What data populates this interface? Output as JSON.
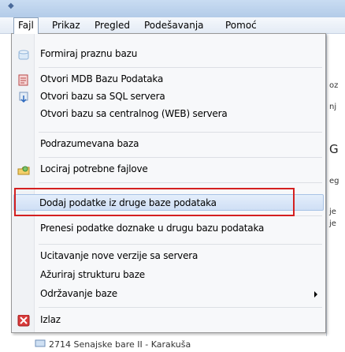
{
  "menubar": {
    "items": [
      "Fajl",
      "Prikaz",
      "Pregled",
      "Podešavanja",
      "Pomoć"
    ]
  },
  "menu": {
    "items": [
      {
        "label": "Formiraj praznu bazu",
        "icon": "new-database-icon"
      },
      {
        "label": "Otvori MDB Bazu Podataka",
        "icon": "mdb-file-icon"
      },
      {
        "label": "Otvori bazu sa SQL servera",
        "icon": "sql-server-icon"
      },
      {
        "label": "Otvori bazu sa centralnog (WEB) servera",
        "icon": ""
      },
      {
        "label": "Podrazumevana baza",
        "icon": ""
      },
      {
        "label": "Lociraj potrebne fajlove",
        "icon": "locate-files-icon"
      },
      {
        "label": "Dodaj podatke iz druge baze podataka",
        "icon": ""
      },
      {
        "label": "Prenesi podatke doznake u drugu bazu podataka",
        "icon": ""
      },
      {
        "label": "Ucitavanje nove verzije sa servera",
        "icon": ""
      },
      {
        "label": "Ažuriraj strukturu baze",
        "icon": ""
      },
      {
        "label": "Održavanje baze",
        "icon": "submenu-arrow-icon"
      },
      {
        "label": "Izlaz",
        "icon": "exit-icon"
      }
    ],
    "highlighted_index": 6
  },
  "background": {
    "snippets": [
      "oz",
      "nj",
      "G",
      "eg",
      "je",
      "je"
    ],
    "status_text": "2714 Senajske bare II - Karakuša"
  },
  "colors": {
    "highlight": "#cfdff5",
    "annotation_box": "#d42020",
    "exit_icon": "#d83a3a"
  }
}
